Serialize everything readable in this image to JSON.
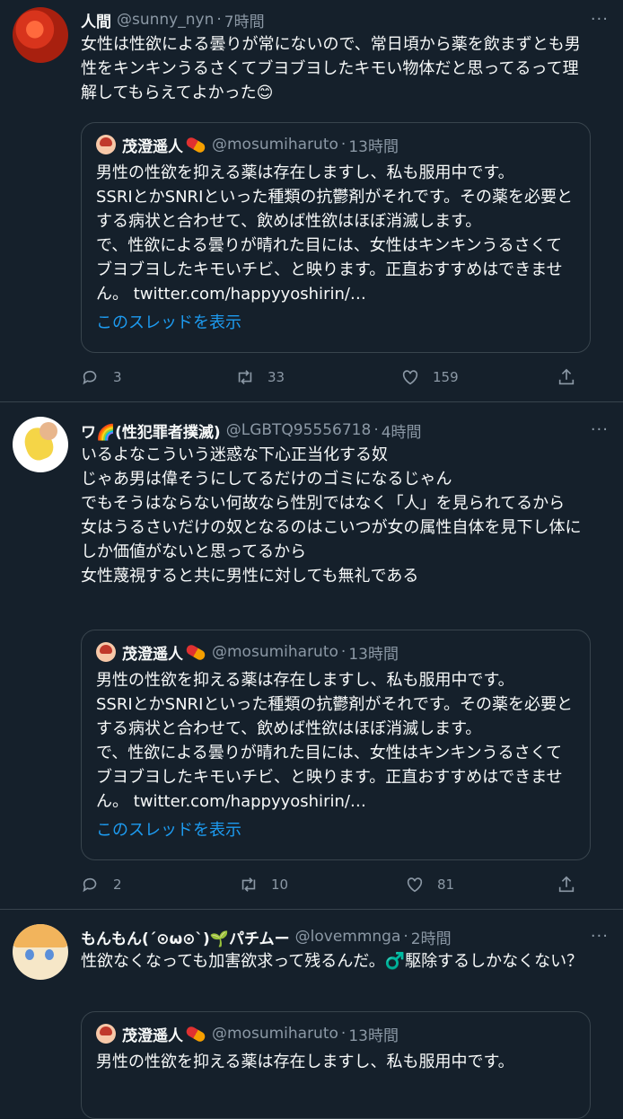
{
  "tweets": [
    {
      "name": "人間",
      "handle": "@sunny_nyn",
      "time": "7時間",
      "text": "女性は性欲による曇りが常にないので、常日頃から薬を飲まずとも男性をキンキンうるさくてブヨブヨしたキモい物体だと思ってるって理解してもらえてよかった😊",
      "replies": "3",
      "retweets": "33",
      "likes": "159"
    },
    {
      "name": "ワ🌈(性犯罪者撲滅)",
      "handle": "@LGBTQ95556718",
      "time": "4時間",
      "text": "いるよなこういう迷惑な下心正当化する奴\nじゃあ男は偉そうにしてるだけのゴミになるじゃん\nでもそうはならない何故なら性別ではなく「人」を見られてるから\n女はうるさいだけの奴となるのはこいつが女の属性自体を見下し体にしか価値がないと思ってるから\n女性蔑視すると共に男性に対しても無礼である",
      "replies": "2",
      "retweets": "10",
      "likes": "81"
    },
    {
      "name": "もんもん(´⊙ω⊙`)🌱パチムー",
      "handle": "@lovemmnga",
      "time": "2時間",
      "text": "性欲なくなっても加害欲求って残るんだ。♂️駆除するしかなくない？"
    }
  ],
  "quote": {
    "name": "茂澄遥人",
    "handle": "@mosumiharuto",
    "time": "13時間",
    "text": "男性の性欲を抑える薬は存在しますし、私も服用中です。\nSSRIとかSNRIといった種類の抗鬱剤がそれです。その薬を必要とする病状と合わせて、飲めば性欲はほぼ消滅します。\nで、性欲による曇りが晴れた目には、女性はキンキンうるさくてブヨブヨしたキモいチビ、と映ります。正直おすすめはできません。 twitter.com/happyyoshirin/…",
    "text_short": "男性の性欲を抑える薬は存在しますし、私も服用中です。",
    "thread_link": "このスレッドを表示"
  },
  "separator": "·",
  "more_label": "···"
}
